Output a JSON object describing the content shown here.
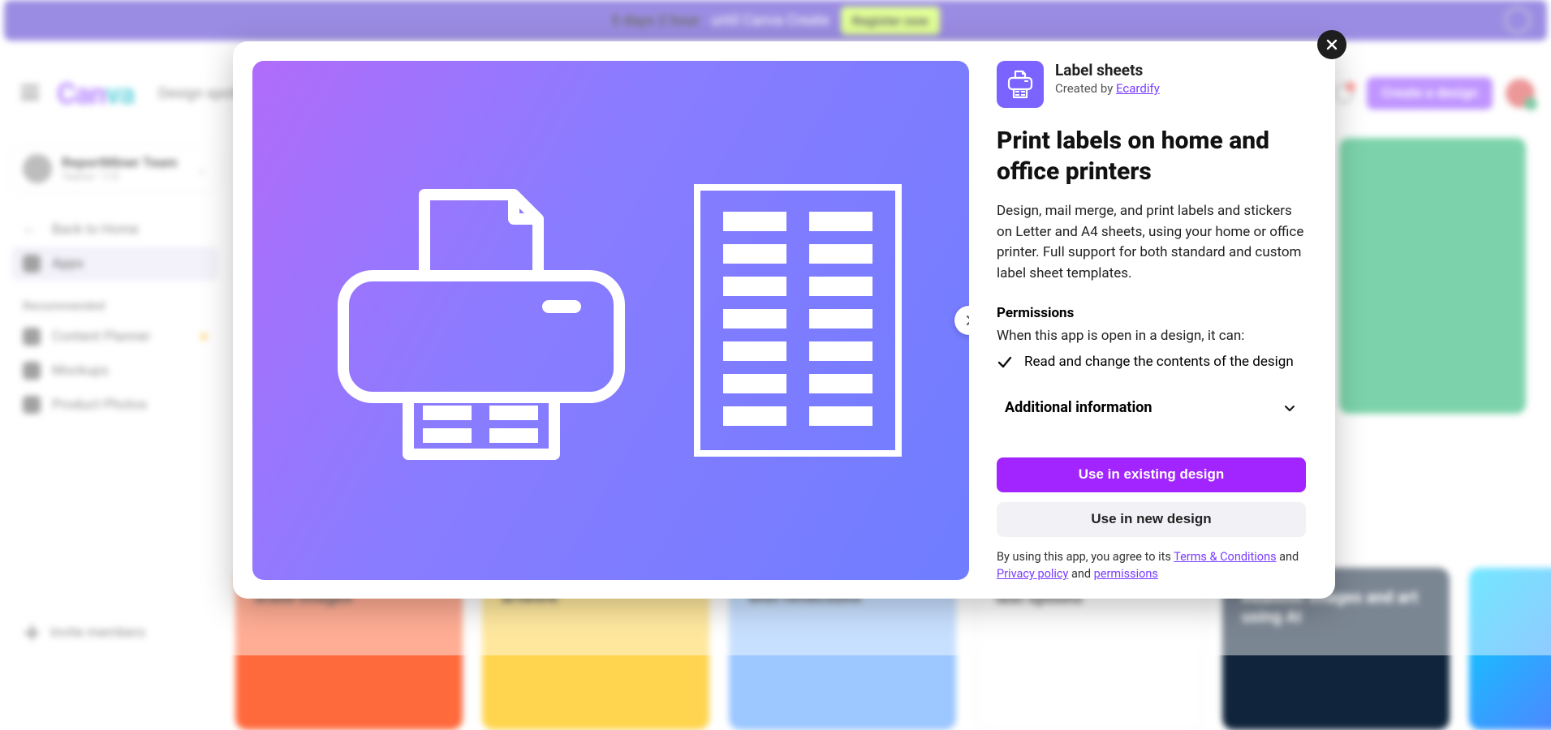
{
  "banner": {
    "highlight": "5 days 2 hour",
    "rest": "until Canva Create",
    "cta": "Register now"
  },
  "header": {
    "logo_a": "Can",
    "logo_b": "va",
    "nav1": "Design spotlight",
    "create": "Create a design"
  },
  "sidebar": {
    "team_name": "ReportMiner Team",
    "team_sub": "Teams • 1/5",
    "back": "Back to Home",
    "apps": "Apps",
    "rec_head": "Recommended",
    "rec": [
      "Content Planner",
      "Mockups",
      "Product Photos"
    ],
    "invite": "Invite members"
  },
  "cards": {
    "c1": "erase images",
    "c2": "artwork",
    "c3": "with reflections",
    "c4": "text options",
    "c5": "Realistic images and art using AI"
  },
  "modal": {
    "app_name": "Label sheets",
    "created_by_prefix": "Created by ",
    "created_by_link": "Ecardify",
    "heading": "Print labels on home and office printers",
    "description": "Design, mail merge, and print labels and stickers on Letter and A4 sheets, using your home or office printer. Full support for both standard and custom label sheet templates.",
    "permissions_heading": "Permissions",
    "permissions_intro": "When this app is open in a design, it can:",
    "permission_item": "Read and change the contents of the design",
    "accordion_label": "Additional information",
    "btn_existing": "Use in existing design",
    "btn_new": "Use in new design",
    "legal_prefix": "By using this app, you agree to its ",
    "legal_terms": "Terms & Conditions",
    "legal_and1": " and ",
    "legal_privacy": "Privacy policy",
    "legal_and2": " and ",
    "legal_permissions": "permissions"
  }
}
